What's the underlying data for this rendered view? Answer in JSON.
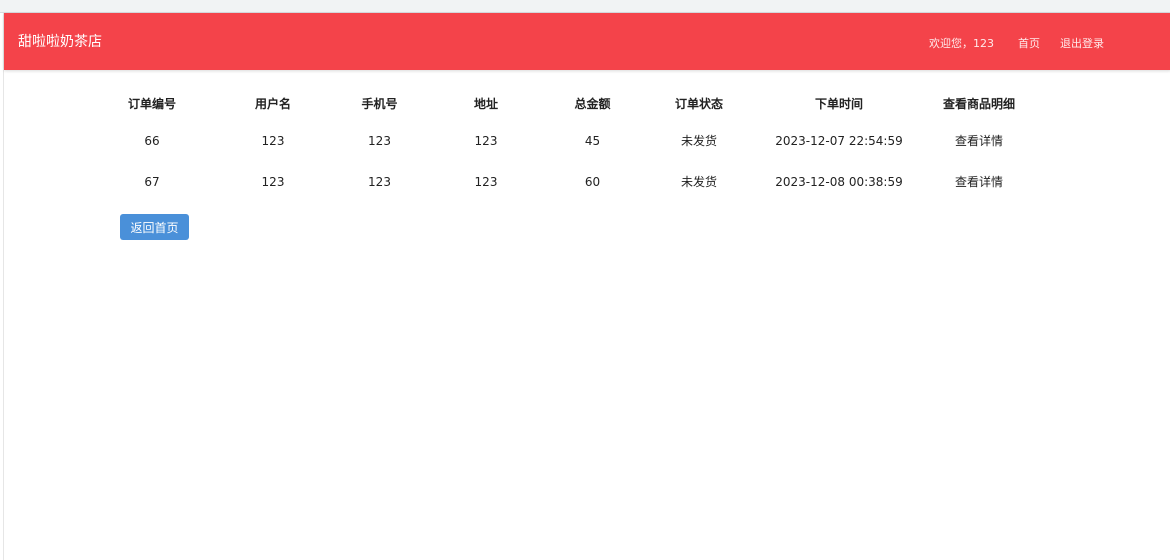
{
  "header": {
    "brand": "甜啦啦奶茶店",
    "welcome": "欢迎您，123",
    "home_link": "首页",
    "logout_link": "退出登录",
    "accent_color": "#f4434a"
  },
  "orders_table": {
    "columns": [
      "订单编号",
      "用户名",
      "手机号",
      "地址",
      "总金额",
      "订单状态",
      "下单时间",
      "查看商品明细"
    ],
    "rows": [
      {
        "order_id": "66",
        "username": "123",
        "phone": "123",
        "address": "123",
        "total": "45",
        "status": "未发货",
        "order_time": "2023-12-07 22:54:59",
        "detail_link": "查看详情"
      },
      {
        "order_id": "67",
        "username": "123",
        "phone": "123",
        "address": "123",
        "total": "60",
        "status": "未发货",
        "order_time": "2023-12-08 00:38:59",
        "detail_link": "查看详情"
      }
    ]
  },
  "back_button": {
    "label": "返回首页",
    "color": "#4a90d9"
  }
}
